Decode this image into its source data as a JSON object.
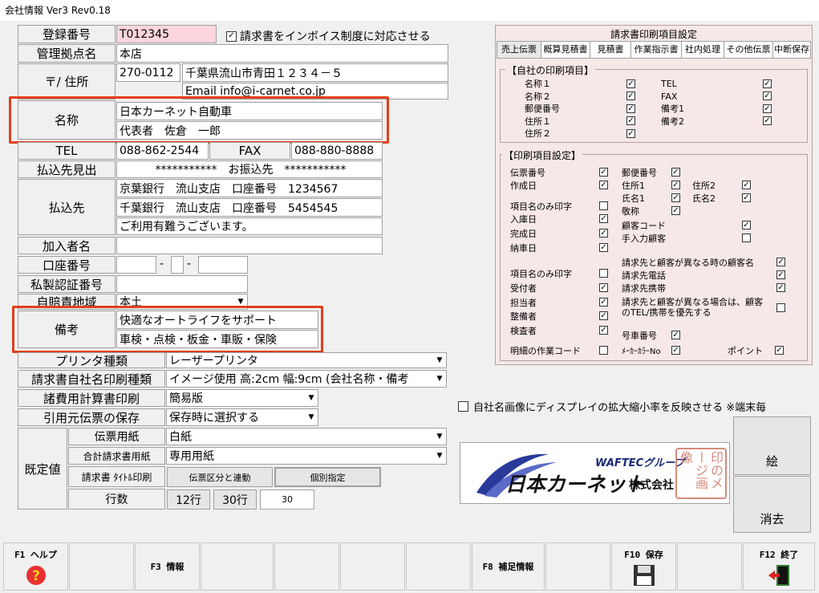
{
  "window": {
    "title": "会社情報 Ver3 Rev0.18"
  },
  "form": {
    "reg_label": "登録番号",
    "reg_value": "T012345",
    "invoice_check_label": "請求書をインボイス制度に対応させる",
    "base_label": "管理拠点名",
    "base_value": "本店",
    "addr_label": "〒/ 住所",
    "zip": "270-0112",
    "address": "千葉県流山市青田１２３４－５",
    "email": "Email info@i-carnet.co.jp",
    "name_label": "名称",
    "name1": "日本カーネット自動車",
    "name2": "代表者　佐倉　一郎",
    "tel_label": "TEL",
    "tel": "088-862-2544",
    "fax_label": "FAX",
    "fax": "088-880-8888",
    "payee_head_label": "払込先見出",
    "payee_head": "***********　お振込先　***********",
    "payee_label": "払込先",
    "payee1": "京葉銀行　流山支店　口座番号　1234567",
    "payee2": "千葉銀行　流山支店　口座番号　5454545",
    "payee3": "ご利用有難うございます。",
    "member_label": "加入者名",
    "account_label": "口座番号",
    "account_sep": "-",
    "private_label": "私製認証番号",
    "insurance_label": "自賠責地域",
    "insurance_value": "本土",
    "remarks_label": "備考",
    "remarks1": "快適なオートライフをサポート",
    "remarks2": "車検・点検・板金・車販・保険",
    "printer_label": "プリンタ種類",
    "printer_value": "レーザープリンタ",
    "invoice_print_label": "請求書自社名印刷種類",
    "invoice_print_value": "イメージ使用 高:2cm 幅:9cm (会社名称・備考",
    "expense_label": "諸費用計算書印刷",
    "expense_value": "簡易版",
    "quote_label": "引用元伝票の保存",
    "quote_value": "保存時に選択する",
    "default_label": "既定値",
    "slip_paper_label": "伝票用紙",
    "slip_paper_value": "白紙",
    "total_paper_label": "合計請求書用紙",
    "total_paper_value": "専用用紙",
    "title_print_label": "請求書 ﾀｲﾄﾙ印刷",
    "title_btn1": "伝票区分と連動",
    "title_btn2": "個別指定",
    "rows_label": "行数",
    "rows_btn1": "12行",
    "rows_btn2": "30行",
    "rows_value": "30"
  },
  "panel": {
    "title": "請求書印刷項目設定",
    "tabs": [
      "売上伝票",
      "概算見積書",
      "見積書",
      "作業指示書",
      "社内処理",
      "その他伝票",
      "中断保存"
    ],
    "own_title": "【自社の印刷項目】",
    "own_left": [
      {
        "label": "名称１",
        "checked": true
      },
      {
        "label": "名称２",
        "checked": true
      },
      {
        "label": "郵便番号",
        "checked": true
      },
      {
        "label": "住所１",
        "checked": true
      },
      {
        "label": "住所２",
        "checked": true
      }
    ],
    "own_right": [
      {
        "label": "TEL",
        "checked": true
      },
      {
        "label": "FAX",
        "checked": true
      },
      {
        "label": "備考1",
        "checked": true
      },
      {
        "label": "備考2",
        "checked": true
      }
    ],
    "print_title": "【印刷項目設定】",
    "col1": [
      {
        "label": "伝票番号",
        "checked": true
      },
      {
        "label": "作成日",
        "checked": true
      },
      {
        "label": "項目名のみ印字",
        "checked": false
      },
      {
        "label": "入庫日",
        "checked": true
      },
      {
        "label": "完成日",
        "checked": true
      },
      {
        "label": "納車日",
        "checked": true
      },
      {
        "label": "項目名のみ印字",
        "checked": false
      },
      {
        "label": "受付者",
        "checked": true
      },
      {
        "label": "担当者",
        "checked": true
      },
      {
        "label": "整備者",
        "checked": true
      },
      {
        "label": "検査者",
        "checked": true
      },
      {
        "label": "明細の作業コード",
        "checked": false
      }
    ],
    "col2a": [
      {
        "label": "郵便番号",
        "checked": true
      },
      {
        "label": "住所1",
        "checked": true
      },
      {
        "label": "氏名1",
        "checked": true
      },
      {
        "label": "敬称",
        "checked": true
      }
    ],
    "col2b": [
      {
        "label": "住所2",
        "checked": true
      },
      {
        "label": "氏名2",
        "checked": true
      }
    ],
    "customer_code": {
      "label": "顧客コード",
      "checked": true
    },
    "manual_customer": {
      "label": "手入力顧客",
      "checked": false
    },
    "diff_name": {
      "label": "請求先と顧客が異なる時の顧客名",
      "checked": true
    },
    "billing_tel": {
      "label": "請求先電話",
      "checked": true
    },
    "billing_mobile": {
      "label": "請求先携帯",
      "checked": true
    },
    "diff_tel": {
      "label": "請求先と顧客が異なる場合は、顧客のTEL/携帯を優先する",
      "checked": false
    },
    "car_number": {
      "label": "号車番号",
      "checked": true
    },
    "maker_color": {
      "label": "ﾒｰｶｰｶﾗｰNo",
      "checked": true
    },
    "point": {
      "label": "ポイント",
      "checked": true
    }
  },
  "display_scale": {
    "label": "自社名画像にディスプレイの拡大縮小率を反映させる ※端末毎",
    "checked": false
  },
  "logo": {
    "group_text": "WAFTECグループ",
    "company": "日本カーネット",
    "suffix": "株式会社",
    "stamp": "印のメージ画像"
  },
  "side_buttons": {
    "picture": "絵",
    "erase": "消去"
  },
  "fkeys": [
    {
      "label": "F1 ヘルプ",
      "icon": "help-icon"
    },
    {
      "label": "",
      "icon": ""
    },
    {
      "label": "F3 情報",
      "icon": ""
    },
    {
      "label": "",
      "icon": ""
    },
    {
      "label": "",
      "icon": ""
    },
    {
      "label": "",
      "icon": ""
    },
    {
      "label": "",
      "icon": ""
    },
    {
      "label": "F8 補足情報",
      "icon": ""
    },
    {
      "label": "",
      "icon": ""
    },
    {
      "label": "F10 保存",
      "icon": "save-icon"
    },
    {
      "label": "",
      "icon": ""
    },
    {
      "label": "F12 終了",
      "icon": "exit-icon"
    }
  ],
  "colors": {
    "highlight": "#e0401b",
    "panel_bg": "#f6e8e8",
    "reg_bg": "#fcd6dc"
  }
}
